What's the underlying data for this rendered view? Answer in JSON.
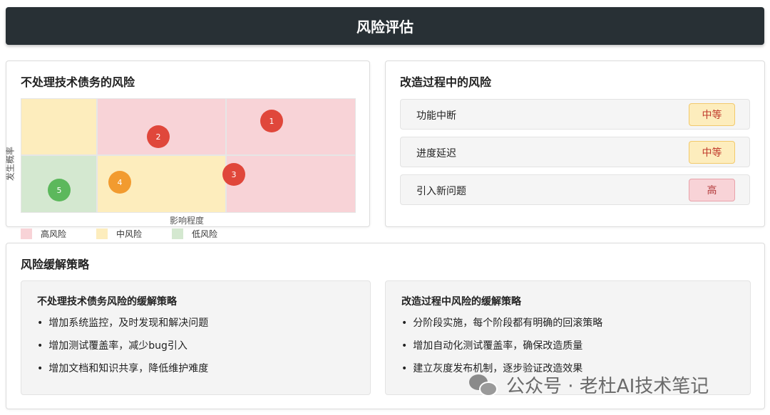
{
  "header": {
    "title": "风险评估"
  },
  "matrix_card": {
    "title": "不处理技术债务的风险",
    "x_label": "影响程度",
    "y_label": "发生概率",
    "points": [
      {
        "label": "1",
        "color": "#e0473b"
      },
      {
        "label": "2",
        "color": "#e0473b"
      },
      {
        "label": "3",
        "color": "#e0473b"
      },
      {
        "label": "4",
        "color": "#f29b2f"
      },
      {
        "label": "5",
        "color": "#5cb85c"
      }
    ],
    "legend": [
      {
        "label": "高风险",
        "color": "#f8d3d7"
      },
      {
        "label": "中风险",
        "color": "#fdedbd"
      },
      {
        "label": "低风险",
        "color": "#d4e8d0"
      }
    ]
  },
  "process_card": {
    "title": "改造过程中的风险",
    "risks": [
      {
        "name": "功能中断",
        "level": "中等",
        "level_bg": "#fdedbd",
        "level_border": "#f2c96b",
        "level_color": "#c0392b"
      },
      {
        "name": "进度延迟",
        "level": "中等",
        "level_bg": "#fdedbd",
        "level_border": "#f2c96b",
        "level_color": "#c0392b"
      },
      {
        "name": "引入新问题",
        "level": "高",
        "level_bg": "#f8d3d7",
        "level_border": "#e8a2aa",
        "level_color": "#b23a3a"
      }
    ]
  },
  "mitigation_card": {
    "title": "风险缓解策略",
    "left": {
      "title": "不处理技术债务风险的缓解策略",
      "items": [
        "增加系统监控，及时发现和解决问题",
        "增加测试覆盖率，减少bug引入",
        "增加文档和知识共享，降低维护难度"
      ]
    },
    "right": {
      "title": "改造过程中风险的缓解策略",
      "items": [
        "分阶段实施，每个阶段都有明确的回滚策略",
        "增加自动化测试覆盖率，确保改造质量",
        "建立灰度发布机制，逐步验证改造效果"
      ]
    }
  },
  "watermark": {
    "text": "公众号 · 老杜AI技术笔记",
    "icon": "wechat-icon"
  }
}
